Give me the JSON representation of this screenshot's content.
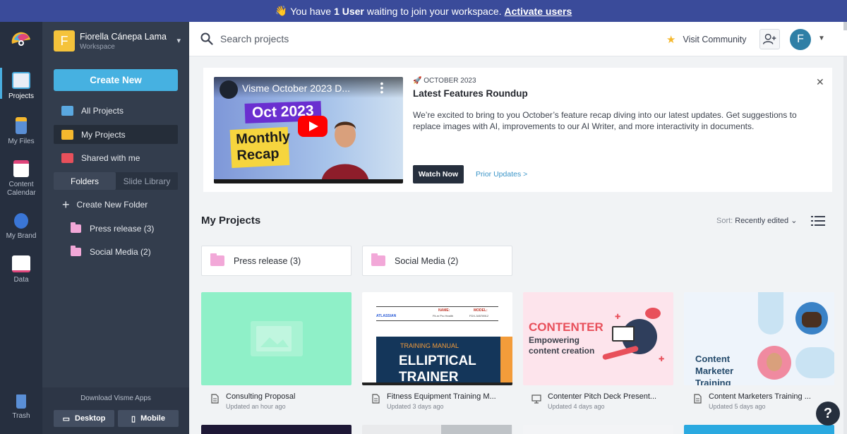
{
  "banner": {
    "prefix": "You have",
    "count": "1 User",
    "suffix": "waiting to join your workspace.",
    "link": "Activate users"
  },
  "rail": {
    "projects": "Projects",
    "my_files": "My Files",
    "content_calendar": "Content Calendar",
    "my_brand": "My Brand",
    "data": "Data",
    "trash": "Trash"
  },
  "workspace": {
    "initial": "F",
    "name": "Fiorella Cánepa Lama",
    "role": "Workspace"
  },
  "sidebar": {
    "create_new": "Create New",
    "nav": [
      {
        "label": "All Projects"
      },
      {
        "label": "My Projects"
      },
      {
        "label": "Shared with me"
      }
    ],
    "tabs": {
      "folders": "Folders",
      "slide_library": "Slide Library"
    },
    "create_folder": "Create New Folder",
    "folders": [
      {
        "label": "Press release (3)"
      },
      {
        "label": "Social Media (2)"
      }
    ],
    "download_label": "Download Visme Apps",
    "desktop": "Desktop",
    "mobile": "Mobile"
  },
  "topbar": {
    "search_placeholder": "Search projects",
    "visit_community": "Visit Community",
    "avatar_initial": "F"
  },
  "promo": {
    "video_title": "Visme October 2023 D...",
    "video_tag1": "Oct 2023",
    "video_tag2": "Monthly Recap",
    "kicker": "OCTOBER 2023",
    "title": "Latest Features Roundup",
    "description": "We’re excited to bring to you October’s feature recap diving into our latest updates. Get suggestions to replace images with AI, improvements to our AI Writer, and more interactivity in documents.",
    "watch_now": "Watch Now",
    "prior_updates": "Prior Updates >"
  },
  "main": {
    "section_title": "My Projects",
    "sort_label": "Sort:",
    "sort_value": "Recently edited",
    "folders": [
      {
        "name": "Press release",
        "count": "(3)"
      },
      {
        "name": "Social Media",
        "count": "(2)"
      }
    ],
    "projects": [
      {
        "title": "Consulting Proposal",
        "updated": "Updated an hour ago",
        "icon": "document-icon"
      },
      {
        "title": "Fitness Equipment Training M...",
        "updated": "Updated 3 days ago",
        "icon": "document-icon",
        "thumb_small1": "NAME:",
        "thumb_small2": "MODEL:",
        "thumb_small3": "Fit-m Pro Health",
        "thumb_small4": "FDX-34578912",
        "thumb_brand": "ATLASSIAN",
        "thumb_kicker": "TRAINING MANUAL",
        "thumb_big1": "ELLIPTICAL",
        "thumb_big2": "TRAINER"
      },
      {
        "title": "Contenter Pitch Deck Present...",
        "updated": "Updated 4 days ago",
        "icon": "presentation-icon",
        "thumb_head": "CONTENTER",
        "thumb_sub1": "Empowering",
        "thumb_sub2": "content creation"
      },
      {
        "title": "Content Marketers Training ...",
        "updated": "Updated 5 days ago",
        "icon": "document-icon",
        "thumb_head1": "Content",
        "thumb_head2": "Marketer",
        "thumb_head3": "Training"
      }
    ]
  },
  "colors": {
    "accent": "#46b1e1",
    "banner": "#3a4b9a",
    "rail": "#262f3f",
    "sidebar": "#333d4d",
    "folder": "#f2a8d8"
  },
  "help": "?"
}
